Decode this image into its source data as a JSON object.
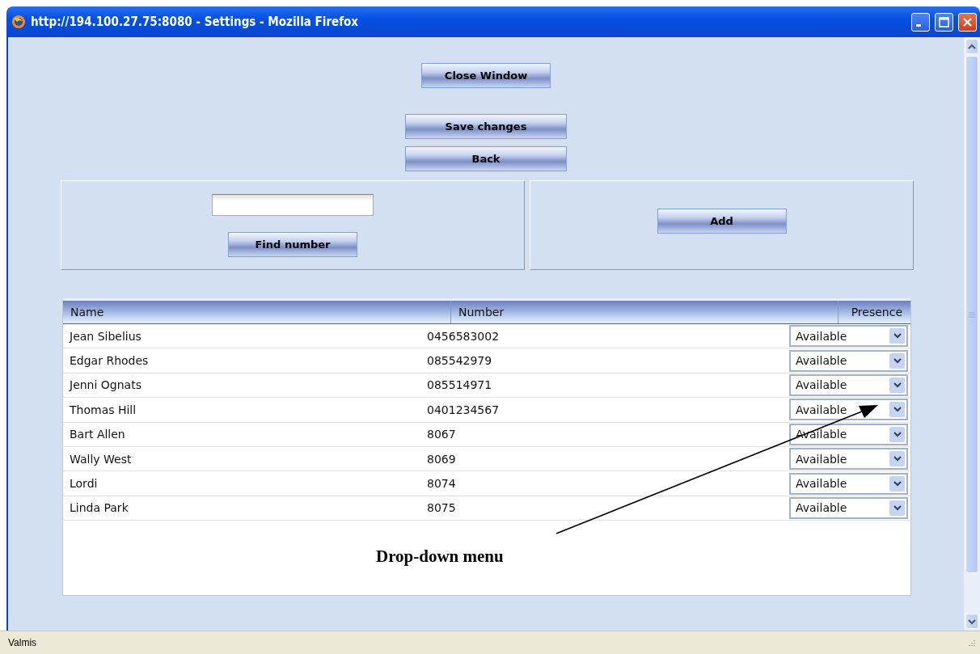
{
  "window": {
    "title": "http://194.100.27.75:8080 - Settings - Mozilla Firefox"
  },
  "top_buttons": [
    "Close Window",
    "Save changes",
    "Back"
  ],
  "search_panel": {
    "button": "Find number"
  },
  "add_panel": {
    "button": "Add"
  },
  "table": {
    "columns": [
      "Name",
      "Number",
      "Presence"
    ],
    "rows": [
      {
        "name": "Jean Sibelius",
        "number": "0456583002",
        "presence": "Available"
      },
      {
        "name": "Edgar Rhodes",
        "number": "085542979",
        "presence": "Available"
      },
      {
        "name": "Jenni Ognats",
        "number": "085514971",
        "presence": "Available"
      },
      {
        "name": "Thomas Hill",
        "number": "0401234567",
        "presence": "Available"
      },
      {
        "name": "Bart Allen",
        "number": "8067",
        "presence": "Available"
      },
      {
        "name": "Wally West",
        "number": "8069",
        "presence": "Available"
      },
      {
        "name": "Lordi",
        "number": "8074",
        "presence": "Available"
      },
      {
        "name": "Linda Park",
        "number": "8075",
        "presence": "Available"
      }
    ]
  },
  "annotation": {
    "text": "Drop-down menu"
  },
  "status_bar": "Valmis"
}
